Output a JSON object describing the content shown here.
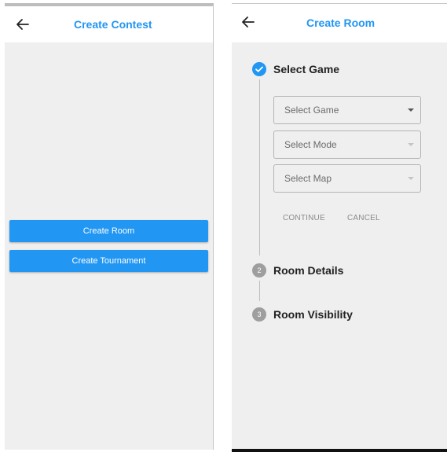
{
  "left_screen": {
    "title": "Create Contest",
    "buttons": {
      "create_room": "Create Room",
      "create_tournament": "Create Tournament"
    }
  },
  "right_screen": {
    "title": "Create Room",
    "steps": [
      {
        "number": "1",
        "label": "Select Game",
        "state": "active",
        "color": "#2196f3"
      },
      {
        "number": "2",
        "label": "Room Details",
        "state": "inactive",
        "color": "#9e9e9e"
      },
      {
        "number": "3",
        "label": "Room Visibility",
        "state": "inactive",
        "color": "#9e9e9e"
      }
    ],
    "selects": {
      "game": "Select Game",
      "mode": "Select Mode",
      "map": "Select Map"
    },
    "actions": {
      "continue": "CONTINUE",
      "cancel": "CANCEL"
    }
  },
  "colors": {
    "accent": "#2196f3",
    "background": "#efefef"
  }
}
